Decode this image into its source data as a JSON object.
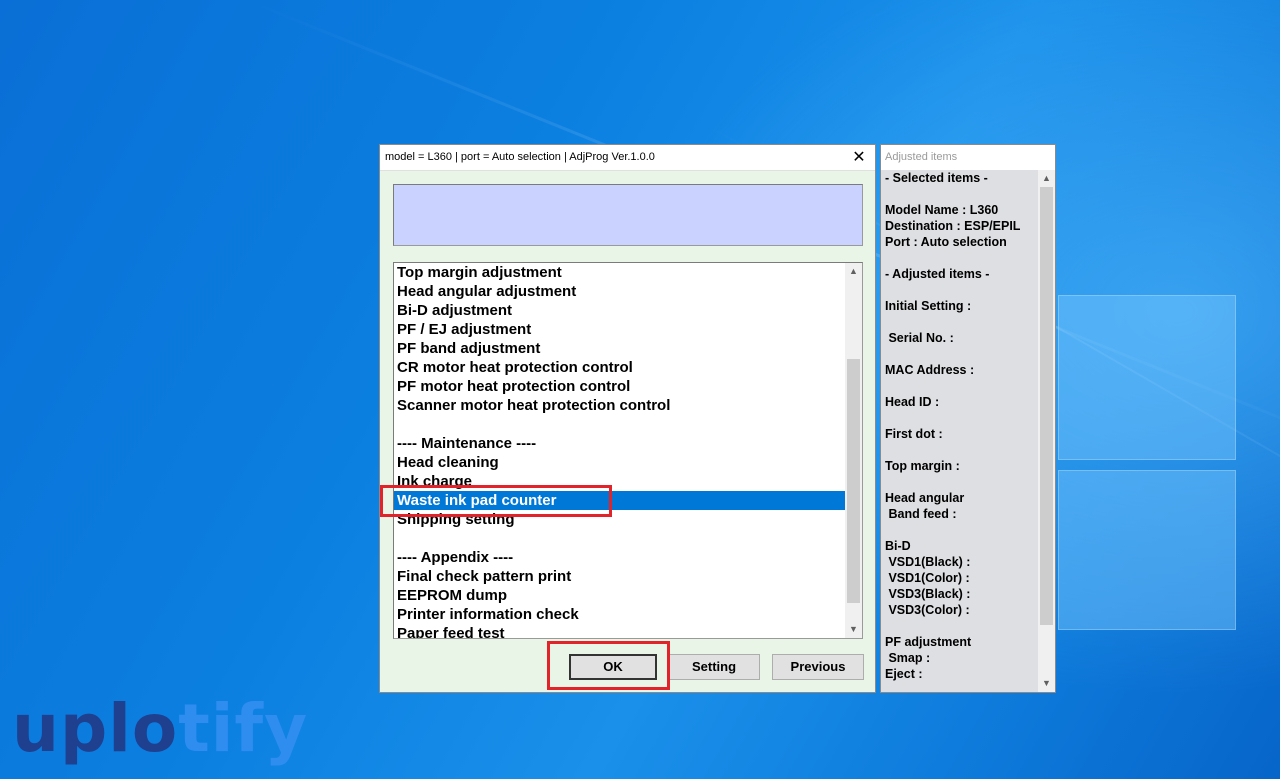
{
  "dialog": {
    "title": "model = L360 | port = Auto selection | AdjProg Ver.1.0.0",
    "close_glyph": "✕",
    "list_items": [
      "Top margin adjustment",
      "Head angular adjustment",
      "Bi-D adjustment",
      "PF / EJ adjustment",
      "PF band adjustment",
      "CR motor heat protection control",
      "PF motor heat protection control",
      "Scanner motor heat protection control",
      "",
      "---- Maintenance ----",
      "Head cleaning",
      "Ink charge",
      "Waste ink pad counter",
      "Shipping setting",
      "",
      "---- Appendix ----",
      "Final check pattern print",
      "EEPROM dump",
      "Printer information check",
      "Paper feed test"
    ],
    "selected_item": "Waste ink pad counter",
    "buttons": {
      "ok": "OK",
      "setting": "Setting",
      "previous": "Previous"
    },
    "scroll_up_glyph": "▲",
    "scroll_down_glyph": "▼"
  },
  "side_panel": {
    "title": "Adjusted items",
    "lines": [
      "- Selected items -",
      "",
      "Model Name : L360",
      "Destination : ESP/EPIL",
      "Port : Auto selection",
      "",
      "- Adjusted items -",
      "",
      "Initial Setting :",
      "",
      " Serial No. :",
      "",
      "MAC Address :",
      "",
      "Head ID :",
      "",
      "First dot :",
      "",
      "Top margin :",
      "",
      "Head angular",
      " Band feed :",
      "",
      "Bi-D",
      " VSD1(Black) :",
      " VSD1(Color) :",
      " VSD3(Black) :",
      " VSD3(Color) :",
      "",
      "PF adjustment",
      " Smap :",
      "Eject :"
    ]
  },
  "watermark": {
    "part1": "uplo",
    "part2": "tify"
  },
  "colors": {
    "selection": "#0078d7",
    "highlight": "#e2232a",
    "message_box": "#cad3ff",
    "dialog_bg": "#e9f5e7"
  }
}
